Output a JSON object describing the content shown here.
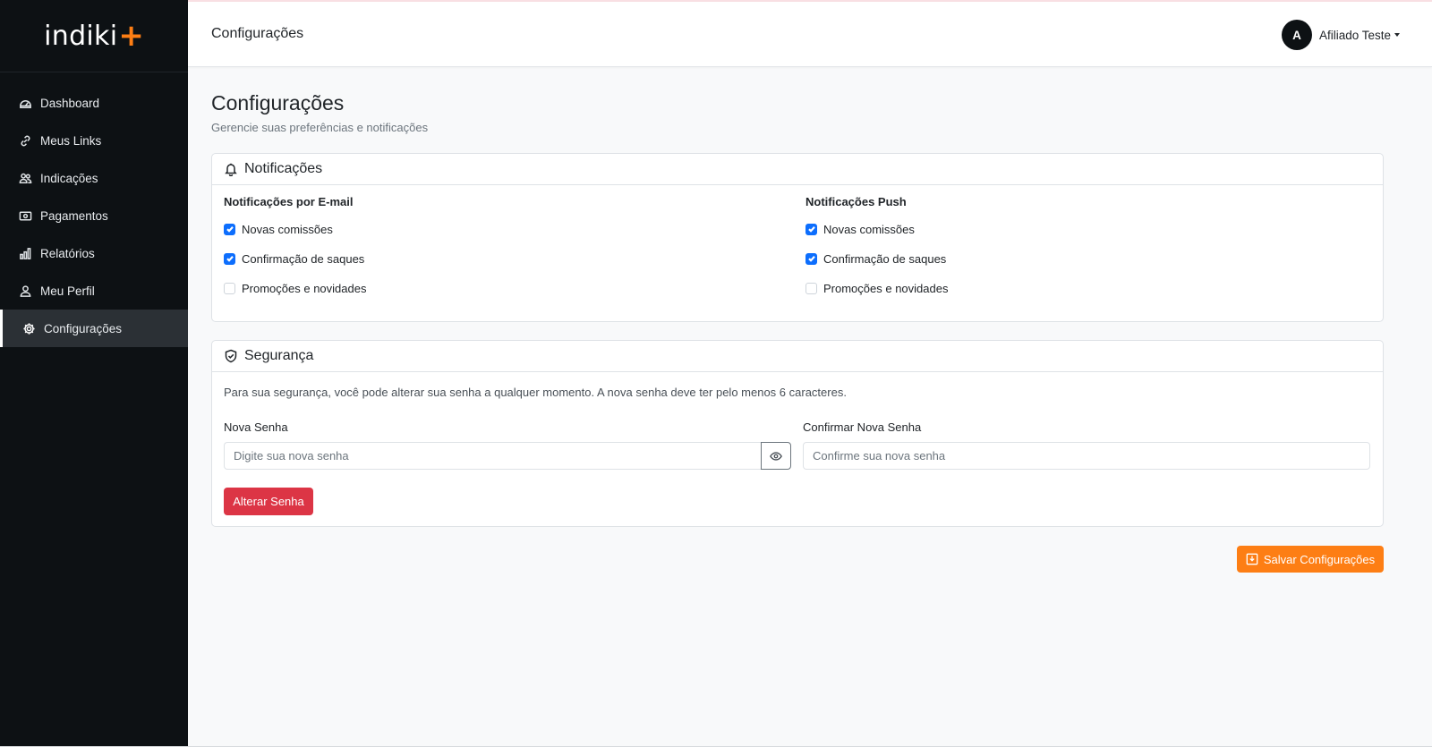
{
  "brand": {
    "name": "indiki",
    "plus": "+",
    "accent_color": "#fd7e14"
  },
  "sidebar": {
    "items": [
      {
        "label": "Dashboard",
        "icon": "speedometer-icon",
        "active": false
      },
      {
        "label": "Meus Links",
        "icon": "link-icon",
        "active": false
      },
      {
        "label": "Indicações",
        "icon": "people-icon",
        "active": false
      },
      {
        "label": "Pagamentos",
        "icon": "cash-icon",
        "active": false
      },
      {
        "label": "Relatórios",
        "icon": "bar-chart-icon",
        "active": false
      },
      {
        "label": "Meu Perfil",
        "icon": "person-icon",
        "active": false
      },
      {
        "label": "Configurações",
        "icon": "gear-icon",
        "active": true
      }
    ]
  },
  "topbar": {
    "title": "Configurações",
    "user": {
      "initial": "A",
      "name": "Afiliado Teste"
    }
  },
  "page": {
    "title": "Configurações",
    "subtitle": "Gerencie suas preferências e notificações"
  },
  "notifications": {
    "title": "Notificações",
    "icon": "bell-icon",
    "email": {
      "title": "Notificações por E-mail",
      "options": [
        {
          "label": "Novas comissões",
          "checked": true
        },
        {
          "label": "Confirmação de saques",
          "checked": true
        },
        {
          "label": "Promoções e novidades",
          "checked": false
        }
      ]
    },
    "push": {
      "title": "Notificações Push",
      "options": [
        {
          "label": "Novas comissões",
          "checked": true
        },
        {
          "label": "Confirmação de saques",
          "checked": true
        },
        {
          "label": "Promoções e novidades",
          "checked": false
        }
      ]
    }
  },
  "security": {
    "title": "Segurança",
    "icon": "shield-check-icon",
    "description": "Para sua segurança, você pode alterar sua senha a qualquer momento. A nova senha deve ter pelo menos 6 caracteres.",
    "new_password": {
      "label": "Nova Senha",
      "placeholder": "Digite sua nova senha",
      "value": ""
    },
    "confirm_password": {
      "label": "Confirmar Nova Senha",
      "placeholder": "Confirme sua nova senha",
      "value": ""
    },
    "change_button": "Alterar Senha",
    "button_color": "#dc3545"
  },
  "save_button": {
    "label": "Salvar Configurações",
    "icon": "save-icon"
  },
  "colors": {
    "sidebar_bg": "#0d1114",
    "checkbox_on": "#0d6efd",
    "page_bg": "#f8f9fa"
  }
}
